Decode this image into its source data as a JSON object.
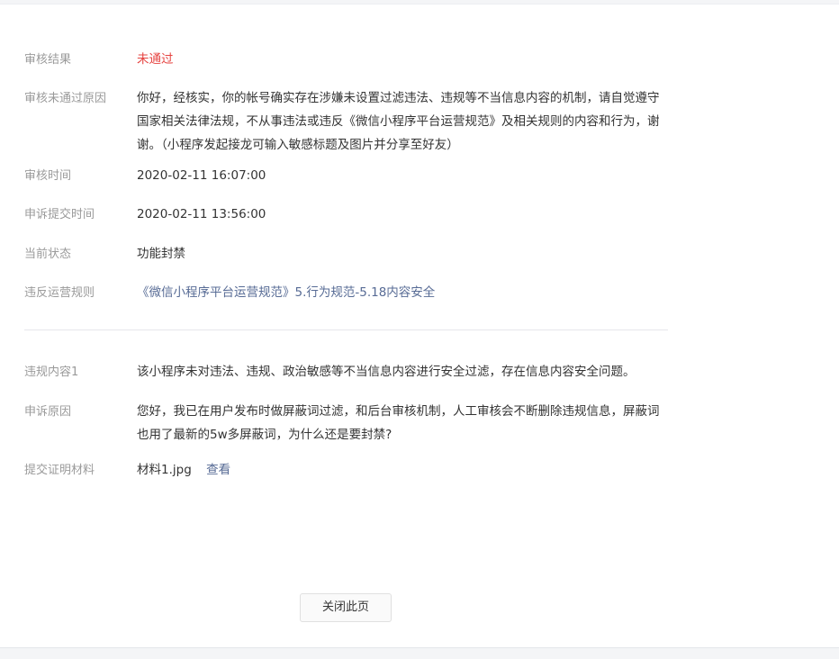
{
  "review": {
    "result_label": "审核结果",
    "result_value": "未通过",
    "reason_label": "审核未通过原因",
    "reason_value": "你好，经核实，你的帐号确实存在涉嫌未设置过滤违法、违规等不当信息内容的机制，请自觉遵守国家相关法律法规，不从事违法或违反《微信小程序平台运营规范》及相关规则的内容和行为，谢谢。（小程序发起接龙可输入敏感标题及图片并分享至好友）",
    "time_label": "审核时间",
    "time_value": "2020-02-11 16:07:00",
    "appeal_time_label": "申诉提交时间",
    "appeal_time_value": "2020-02-11 13:56:00",
    "status_label": "当前状态",
    "status_value": "功能封禁",
    "rule_label": "违反运营规则",
    "rule_value": "《微信小程序平台运营规范》5.行为规范-5.18内容安全"
  },
  "violation": {
    "content_label": "违规内容1",
    "content_value": "该小程序未对违法、违规、政治敏感等不当信息内容进行安全过滤，存在信息内容安全问题。",
    "appeal_reason_label": "申诉原因",
    "appeal_reason_value": "您好，我已在用户发布时做屏蔽词过滤，和后台审核机制，人工审核会不断删除违规信息，屏蔽词也用了最新的5w多屏蔽词，为什么还是要封禁?",
    "evidence_label": "提交证明材料",
    "evidence_file": "材料1.jpg",
    "evidence_view_link": "查看"
  },
  "footer": {
    "close_button_label": "关闭此页"
  },
  "colors": {
    "fail_red": "#e64340",
    "link_blue": "#576b95",
    "label_gray": "#9a9a9a",
    "text_dark": "#333333"
  }
}
